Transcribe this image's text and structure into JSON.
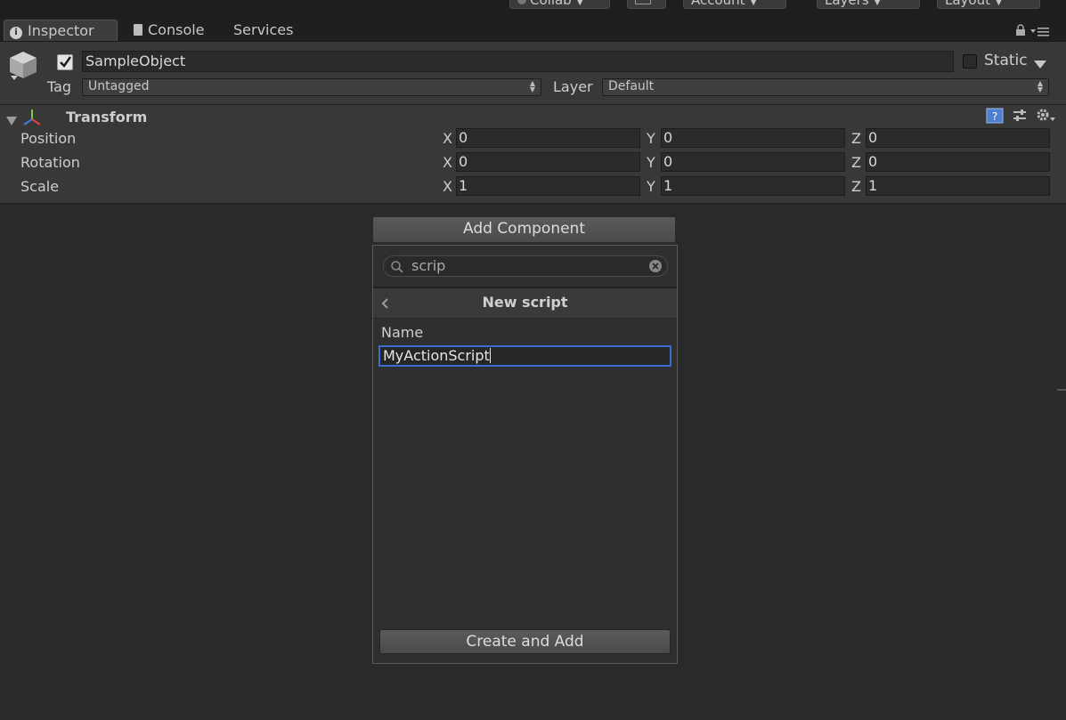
{
  "toolbar": {
    "collab_label": "Collab",
    "account_label": "Account",
    "layers_label": "Layers",
    "layout_label": "Layout"
  },
  "tabs": [
    {
      "label": "Inspector",
      "icon": "info-icon"
    },
    {
      "label": "Console",
      "icon": "console-icon"
    },
    {
      "label": "Services"
    }
  ],
  "inspector": {
    "object_name": "SampleObject",
    "active": true,
    "static_label": "Static",
    "static_checked": false,
    "tag_label": "Tag",
    "tag_value": "Untagged",
    "layer_label": "Layer",
    "layer_value": "Default"
  },
  "transform": {
    "title": "Transform",
    "rows": [
      {
        "label": "Position",
        "x": "0",
        "y": "0",
        "z": "0"
      },
      {
        "label": "Rotation",
        "x": "0",
        "y": "0",
        "z": "0"
      },
      {
        "label": "Scale",
        "x": "1",
        "y": "1",
        "z": "1"
      }
    ],
    "axis_labels": {
      "x": "X",
      "y": "Y",
      "z": "Z"
    }
  },
  "add_component": {
    "button_label": "Add Component",
    "search_value": "scrip",
    "panel_title": "New script",
    "name_label": "Name",
    "name_value": "MyActionScript",
    "create_label": "Create and Add"
  },
  "colors": {
    "background": "#2a2a2a",
    "panel": "#383838",
    "focus_border": "#3d6bd4"
  }
}
